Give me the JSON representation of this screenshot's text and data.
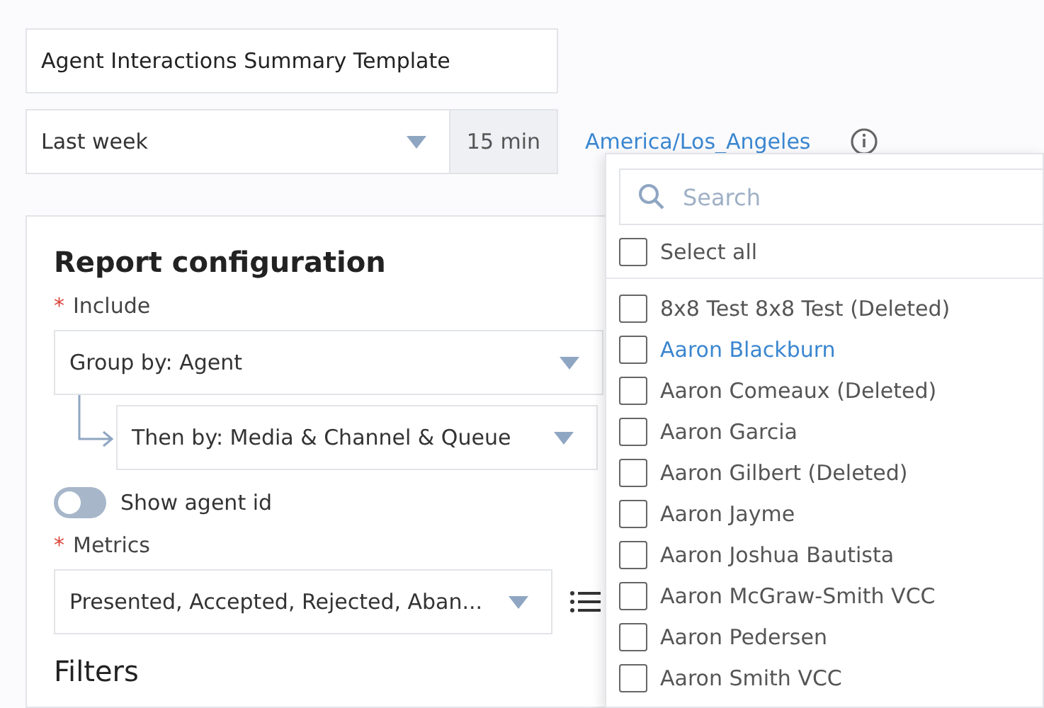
{
  "template_name": {
    "value": "Agent Interactions Summary Template"
  },
  "period": {
    "value": "Last week",
    "interval": "15 min"
  },
  "timezone": {
    "label": "America/Los_Angeles"
  },
  "report_configuration": {
    "title": "Report configuration",
    "include": {
      "label": "Include",
      "required_mark": "*",
      "group_by": "Group by: Agent",
      "then_by": "Then by: Media & Channel & Queue"
    },
    "show_agent_id": {
      "label": "Show agent id",
      "on": false
    },
    "metrics": {
      "label": "Metrics",
      "required_mark": "*",
      "value": "Presented, Accepted, Rejected, Aban..."
    },
    "filters_title": "Filters"
  },
  "agent_dropdown": {
    "search_placeholder": "Search",
    "select_all": {
      "label": "Select all",
      "checked": false
    },
    "items": [
      {
        "label": "8x8 Test 8x8 Test (Deleted)",
        "checked": false,
        "highlighted": false
      },
      {
        "label": "Aaron Blackburn",
        "checked": false,
        "highlighted": true
      },
      {
        "label": "Aaron Comeaux (Deleted)",
        "checked": false,
        "highlighted": false
      },
      {
        "label": "Aaron Garcia",
        "checked": false,
        "highlighted": false
      },
      {
        "label": "Aaron Gilbert (Deleted)",
        "checked": false,
        "highlighted": false
      },
      {
        "label": "Aaron Jayme",
        "checked": false,
        "highlighted": false
      },
      {
        "label": "Aaron Joshua Bautista",
        "checked": false,
        "highlighted": false
      },
      {
        "label": "Aaron McGraw-Smith VCC",
        "checked": false,
        "highlighted": false
      },
      {
        "label": "Aaron Pedersen",
        "checked": false,
        "highlighted": false
      },
      {
        "label": "Aaron Smith VCC",
        "checked": false,
        "highlighted": false
      }
    ]
  }
}
